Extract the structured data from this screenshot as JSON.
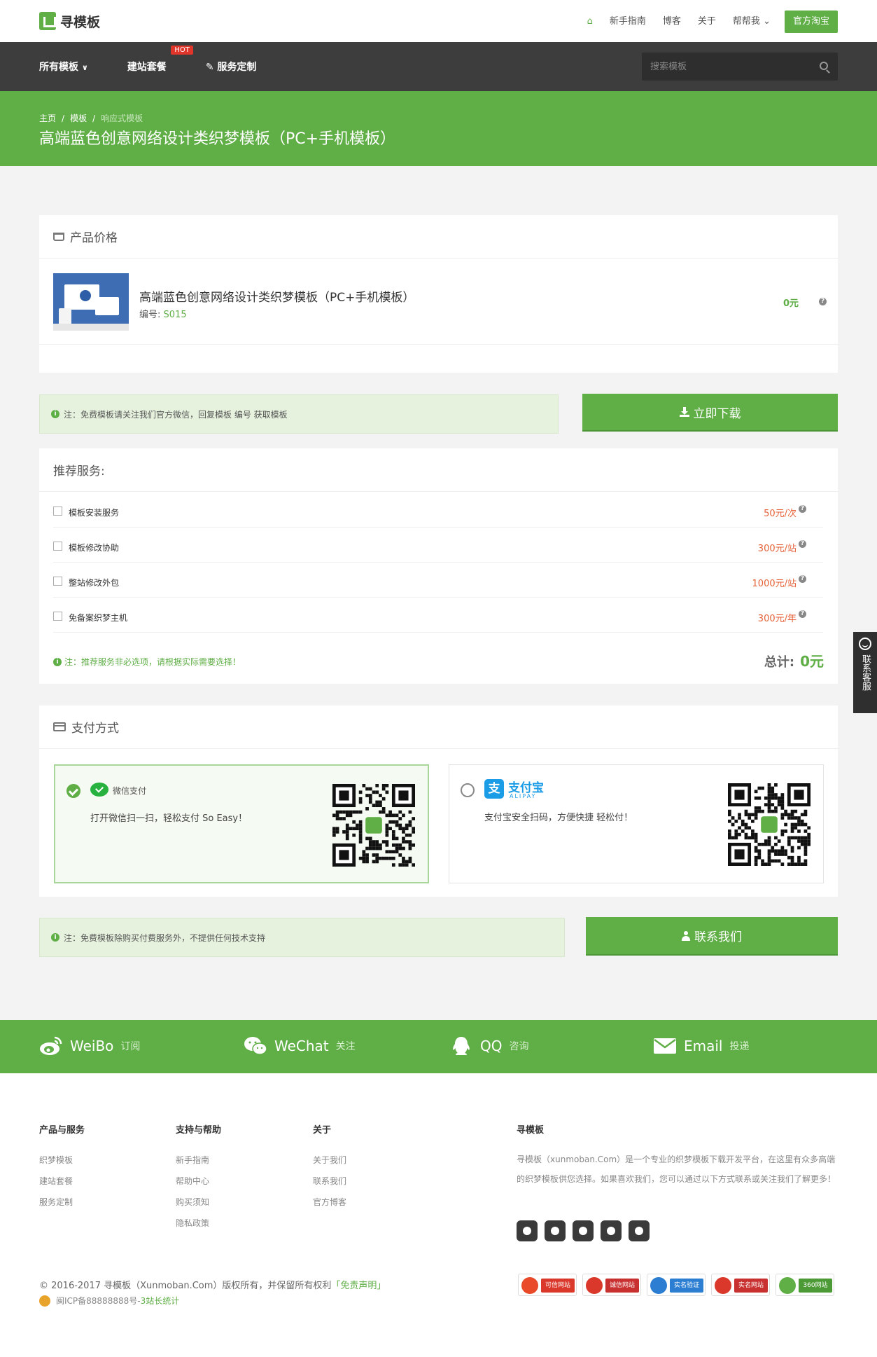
{
  "brand": {
    "logo_text": "寻模板"
  },
  "topnav": {
    "items": [
      "新手指南",
      "博客",
      "关于",
      "帮帮我"
    ],
    "shop_button": "官方淘宝"
  },
  "mainnav": {
    "items": [
      "所有模板",
      "建站套餐",
      "服务定制"
    ],
    "hot_badge": "HOT",
    "search_placeholder": "搜索模板"
  },
  "banner": {
    "breadcrumb": [
      "主页",
      "模板",
      "响应式模板"
    ],
    "title": "高端蓝色创意网络设计类织梦模板（PC+手机模板）"
  },
  "price_panel": {
    "heading": "产品价格",
    "product_name": "高端蓝色创意网络设计类织梦模板（PC+手机模板）",
    "code_label": "编号:",
    "code_value": "S015",
    "price": "0元"
  },
  "notice1": {
    "text": "注：免费模板请关注我们官方微信，回复模板 编号 获取模板"
  },
  "download_button": "立即下载",
  "services": {
    "heading": "推荐服务:",
    "items": [
      {
        "label": "模板安装服务",
        "price": "50元/次"
      },
      {
        "label": "模板修改协助",
        "price": "300元/站"
      },
      {
        "label": "整站修改外包",
        "price": "1000元/站"
      },
      {
        "label": "免备案织梦主机",
        "price": "300元/年"
      }
    ],
    "note": "注：推荐服务非必选项，请根据实际需要选择！",
    "total_label": "总计:",
    "total_value": "0元"
  },
  "payment": {
    "heading": "支付方式",
    "wechat": {
      "name": "微信支付",
      "desc": "打开微信扫一扫，轻松支付 So Easy！"
    },
    "alipay": {
      "name": "支付宝",
      "sub": "ALIPAY",
      "desc": "支付宝安全扫码，方便快捷 轻松付！"
    }
  },
  "notice2": {
    "text": "注：免费模板除购买付费服务外，不提供任何技术支持"
  },
  "contact_button": "联系我们",
  "social": [
    {
      "name": "WeiBo",
      "sub": "订阅"
    },
    {
      "name": "WeChat",
      "sub": "关注"
    },
    {
      "name": "QQ",
      "sub": "咨询"
    },
    {
      "name": "Email",
      "sub": "投递"
    }
  ],
  "footer": {
    "col1": {
      "title": "产品与服务",
      "links": [
        "织梦模板",
        "建站套餐",
        "服务定制"
      ]
    },
    "col2": {
      "title": "支持与帮助",
      "links": [
        "新手指南",
        "帮助中心",
        "购买须知",
        "隐私政策"
      ]
    },
    "col3": {
      "title": "关于",
      "links": [
        "关于我们",
        "联系我们",
        "官方博客"
      ]
    },
    "about": {
      "title": "寻模板",
      "text": "寻模板（xunmoban.Com）是一个专业的织梦模板下载开发平台，在这里有众多高端的织梦模板供您选择。如果喜欢我们，您可以通过以下方式联系或关注我们了解更多！"
    },
    "copyright": "© 2016-2017 寻模板（Xunmoban.Com）版权所有，并保留所有权利",
    "disclaimer": "「免责声明」",
    "icp": "闽ICP备88888888号-",
    "stats": "3站长统计",
    "certs": [
      "可信网站",
      "诚信网站",
      "实名验证",
      "实名网站",
      "360网站"
    ]
  },
  "kefu": "联系客服",
  "colors": {
    "brand_green": "#5fae46",
    "dark_nav": "#3d3d3d",
    "price_red": "#e56138"
  }
}
